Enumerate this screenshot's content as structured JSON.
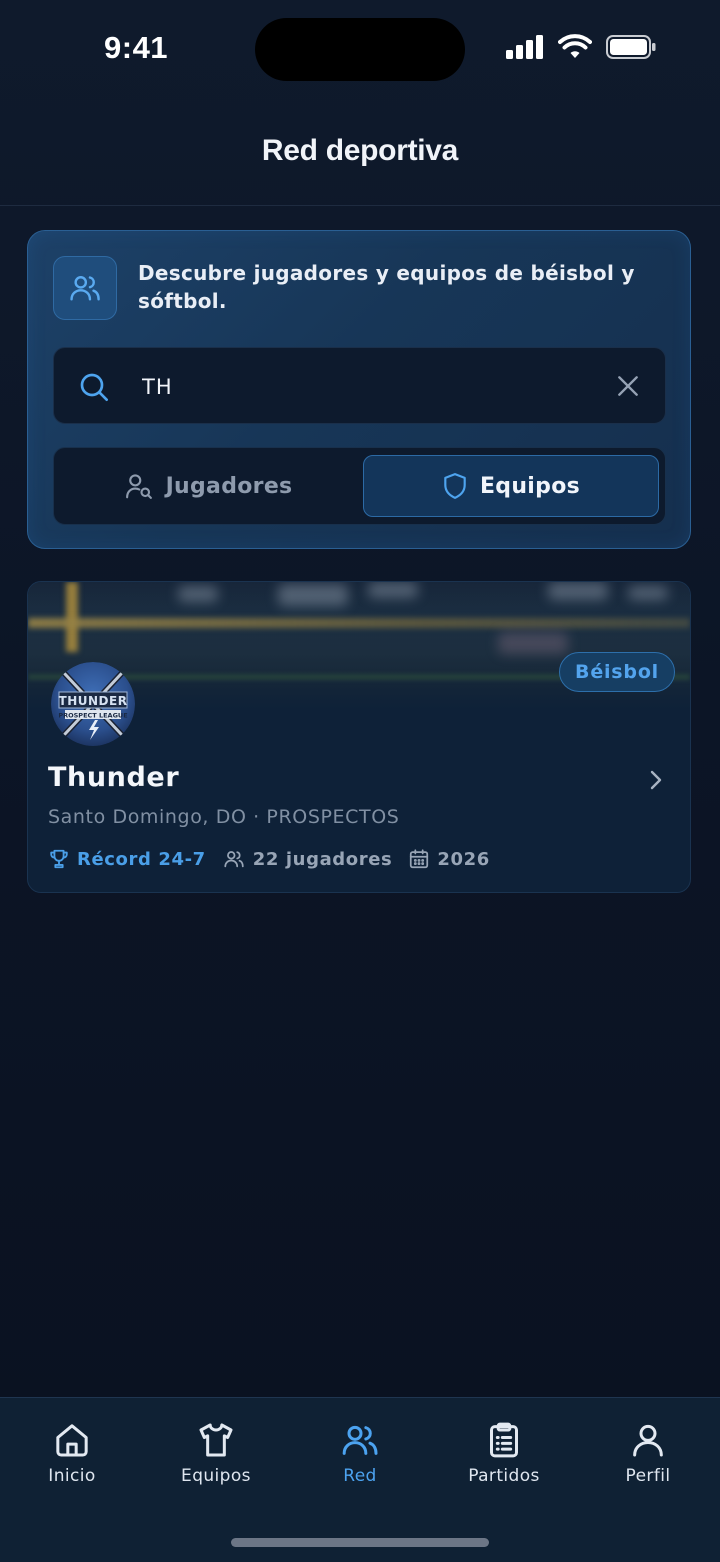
{
  "status_bar": {
    "time": "9:41"
  },
  "header": {
    "title": "Red deportiva"
  },
  "discover": {
    "description": "Descubre jugadores y equipos de béisbol y sóftbol.",
    "search": {
      "value": "TH",
      "placeholder": ""
    },
    "segments": {
      "players_label": "Jugadores",
      "teams_label": "Equipos",
      "selected": "Equipos"
    }
  },
  "results": [
    {
      "name": "Thunder",
      "location": "Santo Domingo, DO · PROSPECTOS",
      "sport": "Béisbol",
      "record": "Récord 24-7",
      "players": "22 jugadores",
      "year": "2026",
      "logo_text": "THUNDER",
      "logo_subtext": "PROSPECT LEAGUE"
    }
  ],
  "tab_bar": {
    "tabs": [
      {
        "label": "Inicio",
        "icon": "home-icon"
      },
      {
        "label": "Equipos",
        "icon": "jersey-icon"
      },
      {
        "label": "Red",
        "icon": "users-icon"
      },
      {
        "label": "Partidos",
        "icon": "clipboard-icon"
      },
      {
        "label": "Perfil",
        "icon": "user-icon"
      }
    ],
    "active": "Red"
  },
  "colors": {
    "background": "#0c1526",
    "accent": "#4ca3f0",
    "panel": "#173657",
    "panel_border": "#2a5f93",
    "text_primary": "#f1f4f9",
    "text_muted": "#8190a3"
  }
}
